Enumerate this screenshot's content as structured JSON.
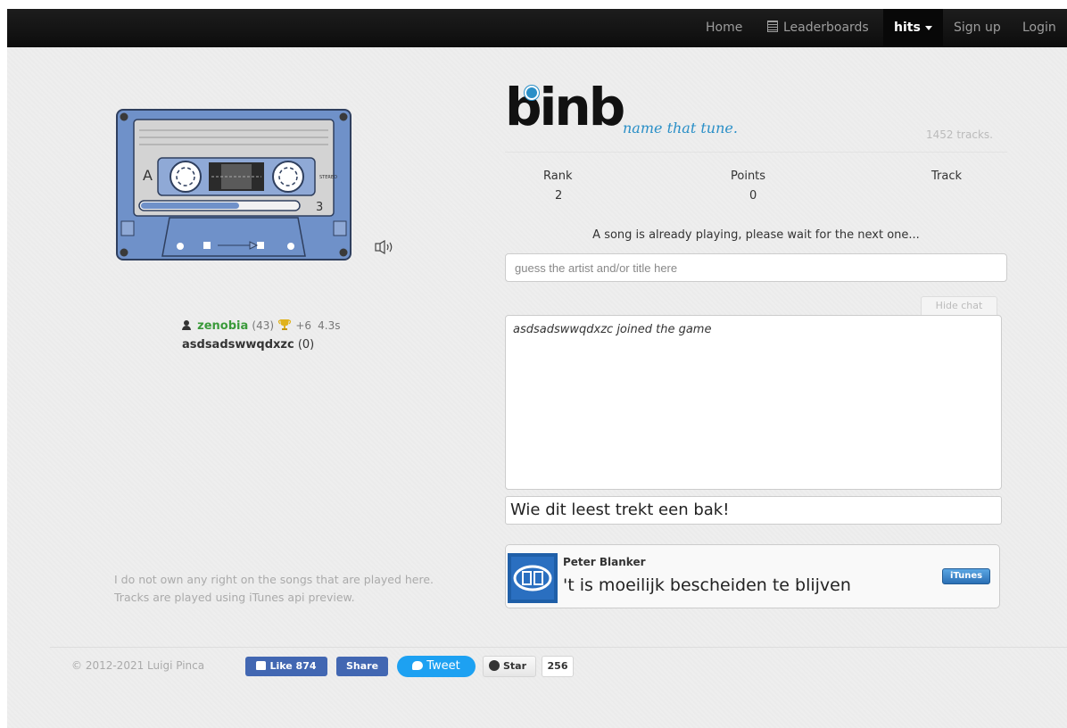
{
  "nav": {
    "home": "Home",
    "leaderboards": "Leaderboards",
    "room": "hits",
    "signup": "Sign up",
    "login": "Login"
  },
  "logo": {
    "wordmark": "binb",
    "tagline": "name that tune.",
    "track_count": "1452 tracks."
  },
  "cassette": {
    "side": "A",
    "label": "STEREO",
    "number": "3"
  },
  "stats": {
    "rank_label": "Rank",
    "rank_value": "2",
    "points_label": "Points",
    "points_value": "0",
    "track_label": "Track",
    "track_value": ""
  },
  "status": "A song is already playing, please wait for the next one...",
  "guess": {
    "placeholder": "guess the artist and/or title here"
  },
  "chat": {
    "hide_label": "Hide chat",
    "messages": [
      "asdsadswwqdxzc joined the game"
    ],
    "input_value": "Wie dit leest trekt een bak!"
  },
  "users": [
    {
      "name": "zenobia",
      "points": "(43)",
      "gain": "+6",
      "time": "4.3s"
    },
    {
      "name": "asdsadswwqdxzc",
      "points": "(0)"
    }
  ],
  "track": {
    "artist": "Peter Blanker",
    "title": "'t is moeilijk bescheiden te blijven",
    "store_button": "iTunes"
  },
  "disclaimer": {
    "line1": "I do not own any right on the songs that are played here.",
    "line2": "Tracks are played using iTunes api preview."
  },
  "footer": {
    "copyright": "© 2012-2021 Luigi Pinca",
    "like_label": "Like 874",
    "share_label": "Share",
    "tweet_label": "Tweet",
    "star_label": "Star",
    "star_count": "256"
  },
  "colors": {
    "navbar": "#111111",
    "accent": "#2a8fc7",
    "user_highlight": "#3a9a3a",
    "cassette_body": "#6f91c9",
    "facebook": "#4267b2",
    "twitter": "#1da1f2"
  }
}
